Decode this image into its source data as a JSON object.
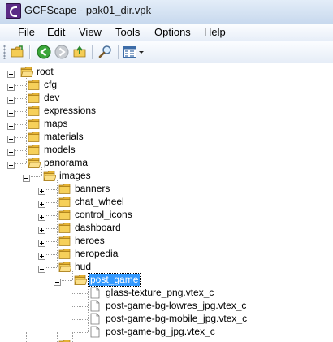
{
  "window": {
    "title": "GCFScape - pak01_dir.vpk"
  },
  "menu": [
    "File",
    "Edit",
    "View",
    "Tools",
    "Options",
    "Help"
  ],
  "toolbar": {
    "icons": [
      "open-folder-icon",
      "back-icon",
      "forward-icon",
      "up-folder-icon",
      "search-icon",
      "view-mode-icon",
      "dropdown-arrow-icon"
    ]
  },
  "tree": [
    {
      "label": "root",
      "type": "folder",
      "depth": 0,
      "state": "expanded"
    },
    {
      "label": "cfg",
      "type": "folder",
      "depth": 1,
      "state": "collapsed"
    },
    {
      "label": "dev",
      "type": "folder",
      "depth": 1,
      "state": "collapsed"
    },
    {
      "label": "expressions",
      "type": "folder",
      "depth": 1,
      "state": "collapsed"
    },
    {
      "label": "maps",
      "type": "folder",
      "depth": 1,
      "state": "collapsed"
    },
    {
      "label": "materials",
      "type": "folder",
      "depth": 1,
      "state": "collapsed"
    },
    {
      "label": "models",
      "type": "folder",
      "depth": 1,
      "state": "collapsed"
    },
    {
      "label": "panorama",
      "type": "folder",
      "depth": 1,
      "state": "expanded"
    },
    {
      "label": "images",
      "type": "folder",
      "depth": 2,
      "state": "expanded"
    },
    {
      "label": "banners",
      "type": "folder",
      "depth": 3,
      "state": "collapsed"
    },
    {
      "label": "chat_wheel",
      "type": "folder",
      "depth": 3,
      "state": "collapsed"
    },
    {
      "label": "control_icons",
      "type": "folder",
      "depth": 3,
      "state": "collapsed"
    },
    {
      "label": "dashboard",
      "type": "folder",
      "depth": 3,
      "state": "collapsed"
    },
    {
      "label": "heroes",
      "type": "folder",
      "depth": 3,
      "state": "collapsed"
    },
    {
      "label": "heropedia",
      "type": "folder",
      "depth": 3,
      "state": "collapsed"
    },
    {
      "label": "hud",
      "type": "folder",
      "depth": 3,
      "state": "expanded"
    },
    {
      "label": "post_game",
      "type": "folder",
      "depth": 4,
      "state": "expanded",
      "selected": true
    },
    {
      "label": "glass-texture_png.vtex_c",
      "type": "file",
      "depth": 5
    },
    {
      "label": "post-game-bg-lowres_jpg.vtex_c",
      "type": "file",
      "depth": 5
    },
    {
      "label": "post-game-bg-mobile_jpg.vtex_c",
      "type": "file",
      "depth": 5
    },
    {
      "label": "post-game-bg_jpg.vtex_c",
      "type": "file",
      "depth": 5
    }
  ],
  "colors": {
    "selection": "#3399ff",
    "folder": "#f2c84b"
  }
}
